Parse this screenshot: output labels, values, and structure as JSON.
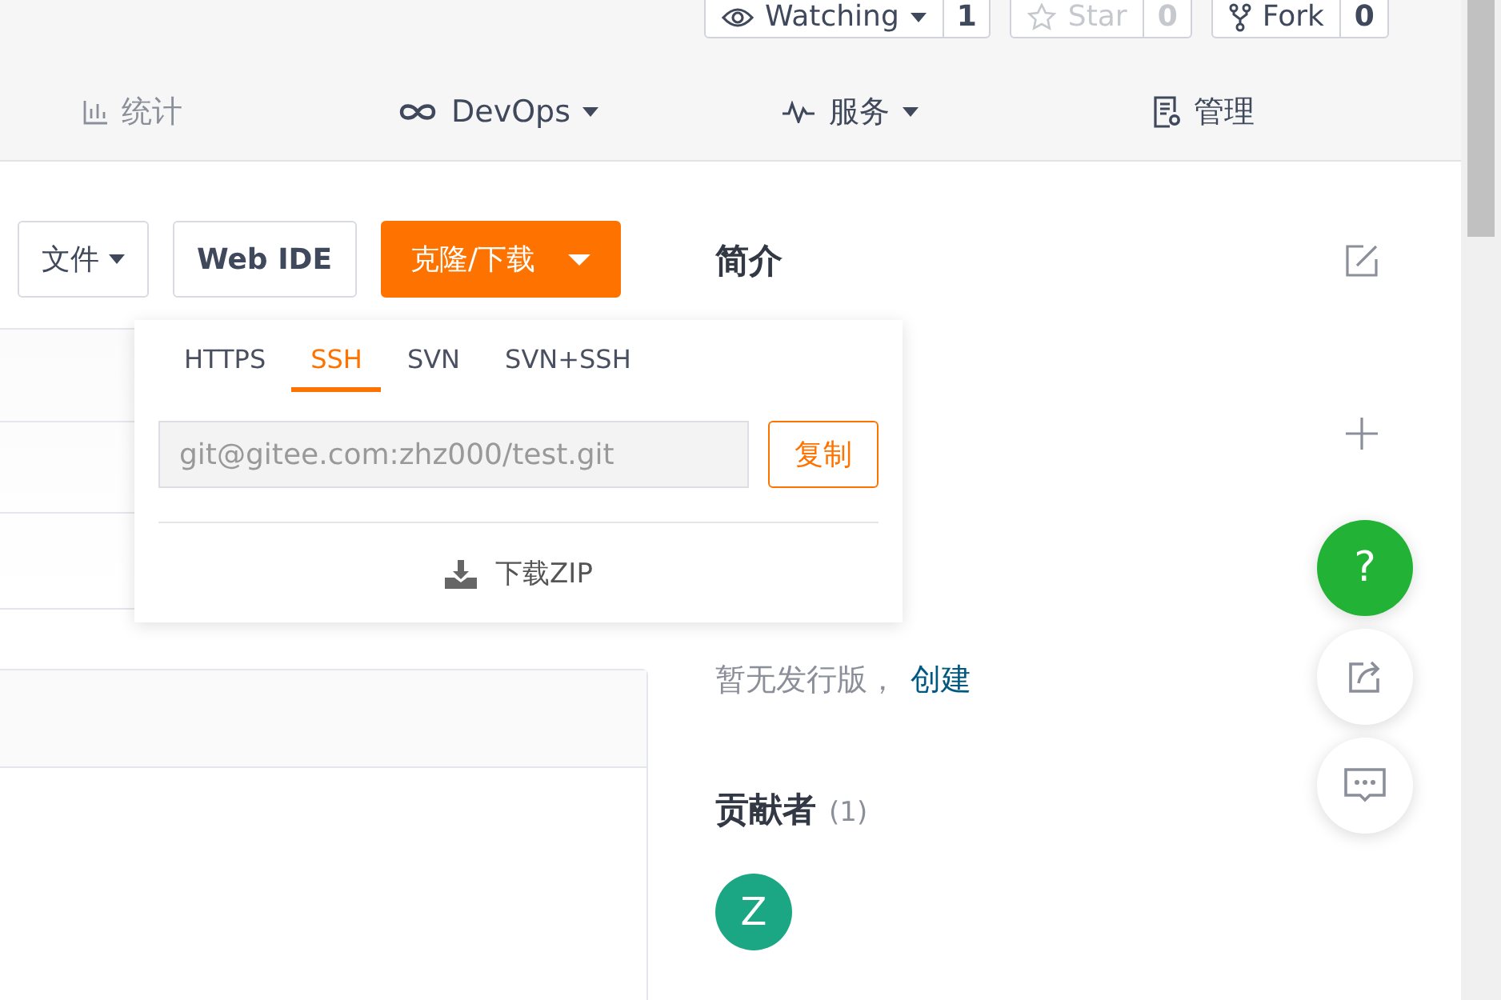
{
  "repo_actions": [
    {
      "kind": "watch",
      "label": "Watching",
      "count": "1",
      "disabled": false
    },
    {
      "kind": "star",
      "label": "Star",
      "count": "0",
      "disabled": true
    },
    {
      "kind": "fork",
      "label": "Fork",
      "count": "0",
      "disabled": false
    }
  ],
  "nav": [
    {
      "kind": "stats",
      "label": "统计",
      "has_menu": false
    },
    {
      "kind": "devops",
      "label": "DevOps",
      "has_menu": true
    },
    {
      "kind": "services",
      "label": "服务",
      "has_menu": true
    },
    {
      "kind": "manage",
      "label": "管理",
      "has_menu": false
    }
  ],
  "toolbar": {
    "file_button": "文件",
    "web_ide_button": "Web IDE",
    "clone_button": "克隆/下载"
  },
  "clone_menu": {
    "tabs": [
      {
        "label": "HTTPS",
        "selected": false
      },
      {
        "label": "SSH",
        "selected": true
      },
      {
        "label": "SVN",
        "selected": false
      },
      {
        "label": "SVN+SSH",
        "selected": false
      }
    ],
    "url": "git@gitee.com:zhz000/test.git",
    "copy_button": "复制",
    "download": "下载ZIP"
  },
  "sidebar": {
    "intro_title": "简介",
    "releases_text": "暂无发行版，",
    "create_link": "创建",
    "contributors_title": "贡献者",
    "contributors_count": "(1)",
    "contributors": [
      {
        "initial": "Z",
        "color": "#1ba784"
      }
    ]
  },
  "floating": {
    "help": "?"
  }
}
